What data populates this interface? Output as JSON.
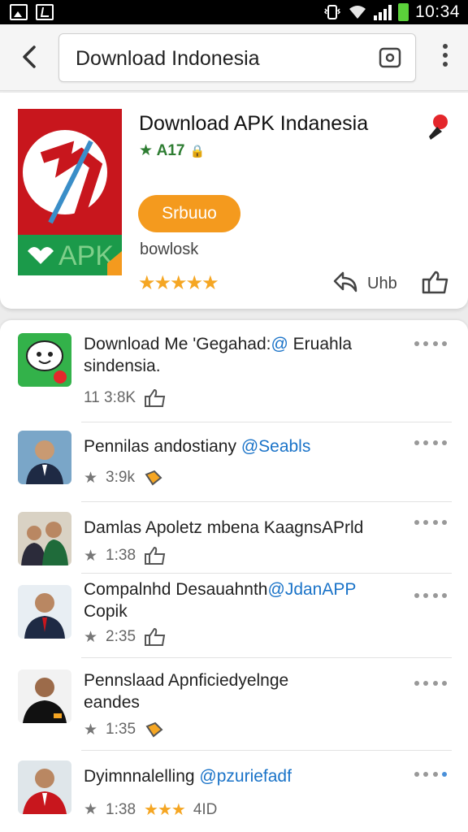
{
  "status_bar": {
    "time": "10:34"
  },
  "search": {
    "query": "Download Indonesia"
  },
  "app": {
    "title": "Download APK Indanesia",
    "rating": "★ A17",
    "install_label": "Srbuuo",
    "subtitle": "bowlosk",
    "share_label": "Uhb",
    "logo_text": "APK"
  },
  "list": [
    {
      "title": "Download Me 'Gegahad:",
      "mention": "@",
      "title_rest": " Eruahla",
      "line2": "sindensia.",
      "meta": "11 3:8K"
    },
    {
      "title": "Pennilas andostiany ",
      "mention": "@Seabls",
      "title_rest": "",
      "line2": "",
      "meta": "3:9k"
    },
    {
      "title": "Damlas Apoletz mbena KaagnsAPrld",
      "mention": "",
      "title_rest": "",
      "line2": "",
      "meta": "1:38"
    },
    {
      "title": "Compalnhd Desauahnth",
      "mention": "@JdanAPP",
      "title_rest": "",
      "line2": "Copik",
      "meta": "2:35"
    },
    {
      "title": "Pennslaad Apnficiedyelnge",
      "mention": "",
      "title_rest": "",
      "line2": "eandes",
      "meta": "1:35"
    },
    {
      "title": "Dyimnnalelling ",
      "mention": "@pzuriefadf",
      "title_rest": "",
      "line2": "",
      "meta": "1:38",
      "extra": "4ID"
    }
  ],
  "colors": {
    "accent": "#f49a1e",
    "link": "#1a73c8",
    "star": "#f5a623",
    "green": "#2e7d32"
  }
}
